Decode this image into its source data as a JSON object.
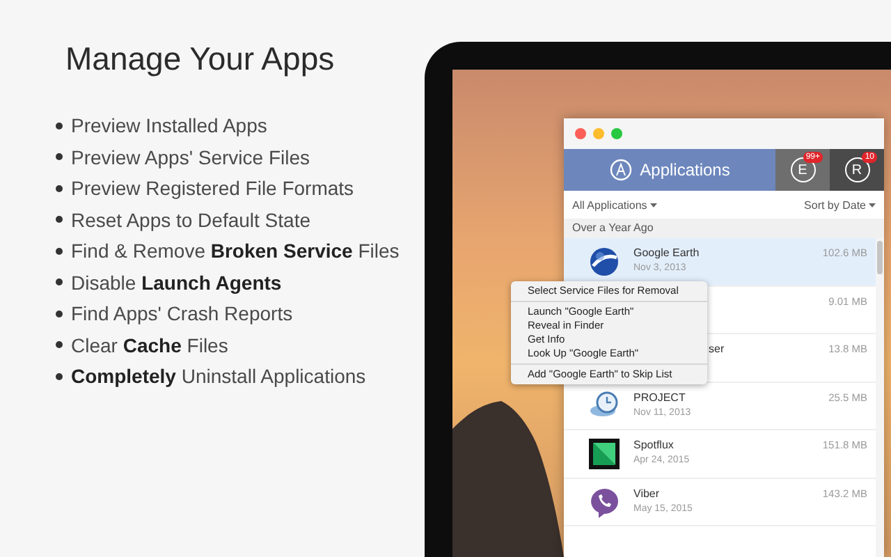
{
  "heading": "Manage Your Apps",
  "features": [
    "Preview Installed Apps",
    "Preview Apps' Service Files",
    "Preview Registered File Formats",
    "Reset Apps to Default State",
    "Find & Remove **Broken Service** Files",
    "Disable **Launch Agents**",
    "Find Apps' Crash Reports",
    "Clear **Cache** Files",
    "**Completely** Uninstall Applications"
  ],
  "window": {
    "tabs": [
      {
        "kind": "applications",
        "label": "Applications",
        "selected": true
      },
      {
        "kind": "letter",
        "label": "E",
        "badge": "99+",
        "selected": false
      },
      {
        "kind": "letter",
        "label": "R",
        "badge": "10",
        "selected": false
      }
    ],
    "filter": "All Applications",
    "sort": "Sort by Date",
    "section": "Over a Year Ago",
    "rows": [
      {
        "kind": "globe",
        "name": "Google Earth",
        "date": "Nov 3, 2013",
        "size": "102.6 MB",
        "selected": true
      },
      {
        "kind": "covered",
        "size": "9.01 MB",
        "selected": false
      },
      {
        "kind": "covered",
        "name": "ser",
        "size": "13.8 MB",
        "selected": false
      },
      {
        "kind": "clock",
        "name": "PROJECT",
        "date": "Nov 11, 2013",
        "size": "25.5 MB",
        "selected": false
      },
      {
        "kind": "square",
        "name": "Spotflux",
        "date": "Apr 24, 2015",
        "size": "151.8 MB",
        "selected": false
      },
      {
        "kind": "phone",
        "name": "Viber",
        "date": "May 15, 2015",
        "size": "143.2 MB",
        "selected": false
      }
    ]
  },
  "context_menu": [
    [
      "Select Service Files for Removal"
    ],
    [
      "Launch \"Google Earth\"",
      "Reveal in Finder",
      "Get Info",
      "Look Up \"Google Earth\""
    ],
    [
      "Add \"Google Earth\" to Skip List"
    ]
  ]
}
